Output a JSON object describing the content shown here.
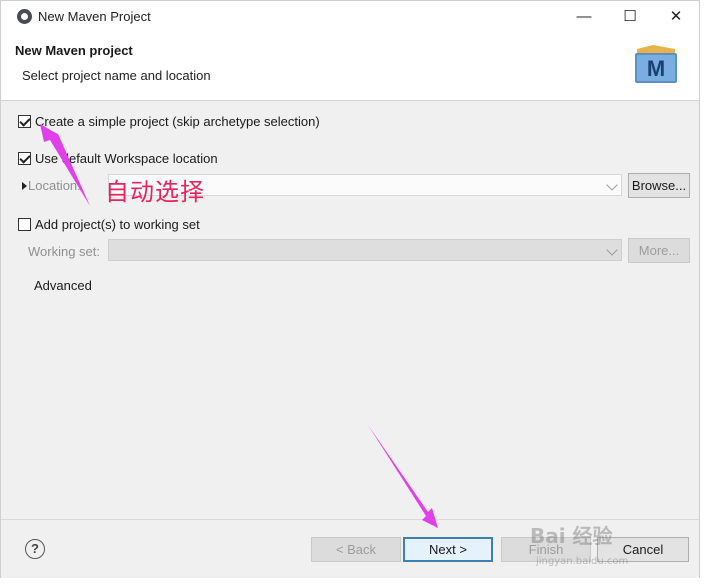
{
  "window": {
    "title": "New Maven Project",
    "minimize_icon": "minimize-icon",
    "maximize_icon": "maximize-icon",
    "close_icon": "close-icon"
  },
  "header": {
    "title": "New Maven project",
    "subtitle": "Select project name and location",
    "logo_icon": "maven-logo-icon",
    "logo_letter": "M"
  },
  "options": {
    "simple_project": {
      "label": "Create a simple project (skip archetype selection)",
      "checked": true
    },
    "default_workspace": {
      "label": "Use default Workspace location",
      "checked": true
    },
    "location": {
      "label": "Location:",
      "value": "",
      "browse_label": "Browse..."
    },
    "working_set_cb": {
      "label": "Add project(s) to working set",
      "checked": false
    },
    "working_set": {
      "label": "Working set:",
      "value": "",
      "more_label": "More..."
    },
    "advanced_label": "Advanced"
  },
  "footer": {
    "help_icon": "help-icon",
    "back_label": "< Back",
    "next_label": "Next >",
    "finish_label": "Finish",
    "cancel_label": "Cancel"
  },
  "annotation": {
    "text": "自动选择",
    "color": "#e8245c",
    "arrow_color": "#e040e8"
  },
  "watermark": {
    "text": "Bai 经验",
    "subtext": "jingyan.baidu.com"
  },
  "colors": {
    "dialog_bg": "#f0f0f0",
    "primary_border": "#3c7fb1"
  }
}
